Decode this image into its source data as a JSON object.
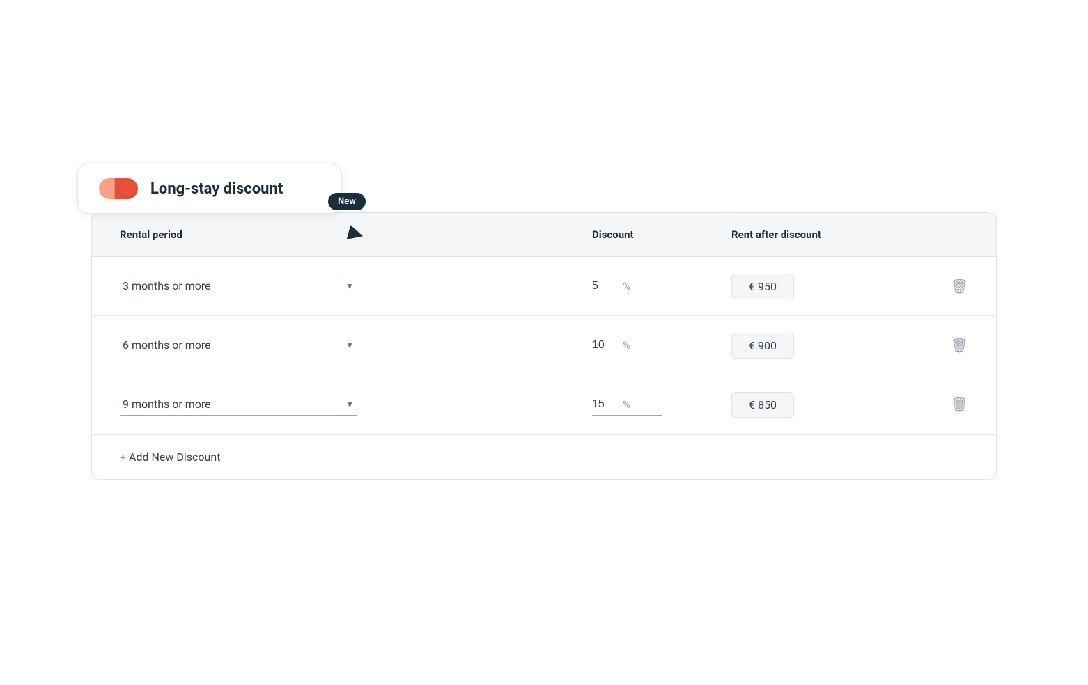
{
  "toggle": {
    "label": "Long-stay discount",
    "active": true
  },
  "badge": {
    "text": "New"
  },
  "table": {
    "headers": {
      "period": "Rental period",
      "discount": "Discount",
      "rent": "Rent after discount"
    },
    "rows": [
      {
        "id": 1,
        "period": "3 months or more",
        "discount": "5",
        "percent": "%",
        "rent": "€ 950"
      },
      {
        "id": 2,
        "period": "6 months or more",
        "discount": "10",
        "percent": "%",
        "rent": "€ 900"
      },
      {
        "id": 3,
        "period": "9 months or more",
        "discount": "15",
        "percent": "%",
        "rent": "€ 850"
      }
    ],
    "add_button": "+ Add New Discount"
  }
}
